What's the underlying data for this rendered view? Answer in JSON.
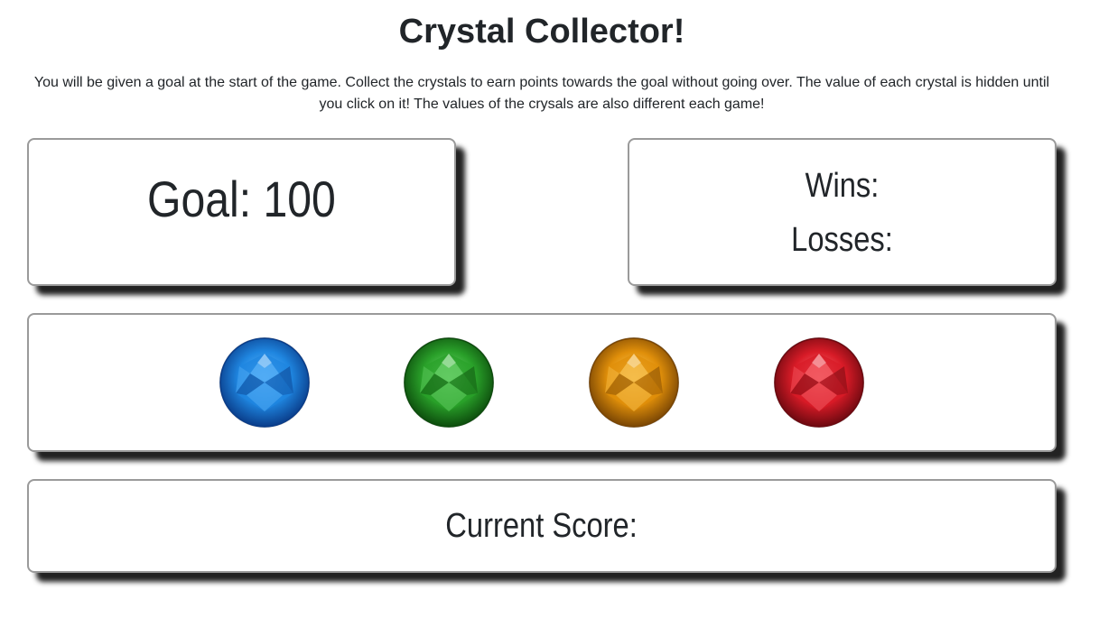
{
  "header": {
    "title": "Crystal Collector!",
    "instructions": "You will be given a goal at the start of the game. Collect the crystals to earn points towards the goal without going over. The value of each crystal is hidden until you click on it! The values of the crysals are also different each game!"
  },
  "goal": {
    "label": "Goal: 100"
  },
  "record": {
    "wins_label": "Wins:",
    "losses_label": "Losses:"
  },
  "crystals": [
    {
      "name": "blue-crystal",
      "color": "#1f86e0",
      "light": "#6cc0ff",
      "dark": "#0a3d8a"
    },
    {
      "name": "green-crystal",
      "color": "#2aa12a",
      "light": "#7fe07f",
      "dark": "#0d4d0d"
    },
    {
      "name": "orange-crystal",
      "color": "#e08f0a",
      "light": "#ffd36b",
      "dark": "#7a4604"
    },
    {
      "name": "red-crystal",
      "color": "#d81b27",
      "light": "#ff7a80",
      "dark": "#6d0910"
    }
  ],
  "score": {
    "label": "Current Score:"
  }
}
